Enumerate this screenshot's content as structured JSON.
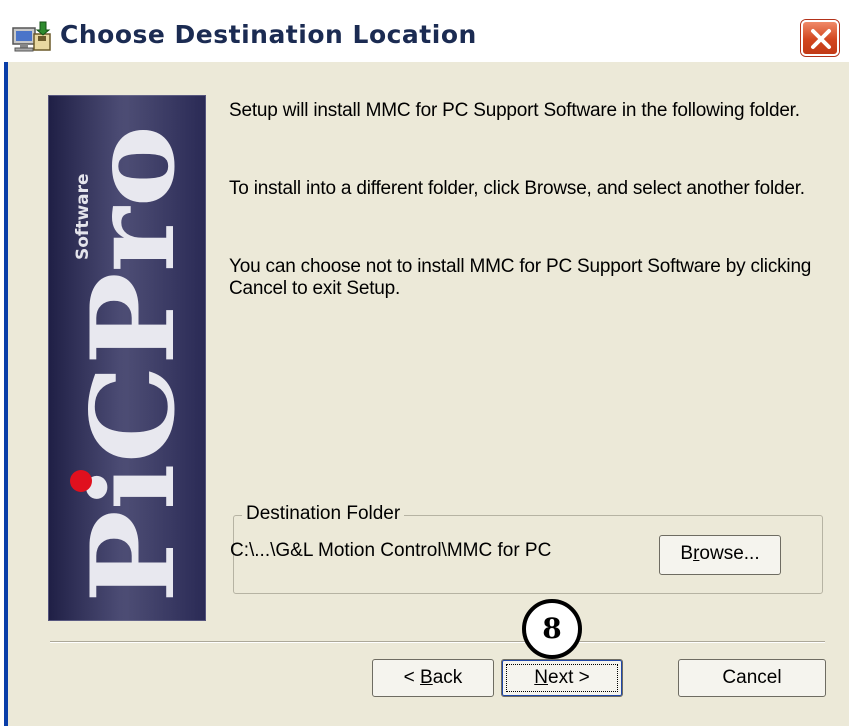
{
  "window": {
    "title": "Choose Destination Location",
    "icon": "installer-computer-icon",
    "close_icon": "close-icon"
  },
  "logo": {
    "brand": "PiCPro",
    "tagline": "Software",
    "dot_color": "#e0101e"
  },
  "content": {
    "paragraph1": "Setup will install MMC for PC Support Software in the following folder.",
    "paragraph2": "To install into a different folder, click Browse, and select another folder.",
    "paragraph3": "You can choose not to install MMC for PC Support Software by clicking Cancel to exit Setup."
  },
  "destination": {
    "group_label": "Destination Folder",
    "path": "C:\\...\\G&L Motion Control\\MMC for PC",
    "browse_pre": "B",
    "browse_key": "r",
    "browse_post": "owse..."
  },
  "annotation": {
    "step_number": "8"
  },
  "buttons": {
    "back_pre": "< ",
    "back_key": "B",
    "back_post": "ack",
    "next_key": "N",
    "next_post": "ext >",
    "cancel_label": "Cancel"
  }
}
